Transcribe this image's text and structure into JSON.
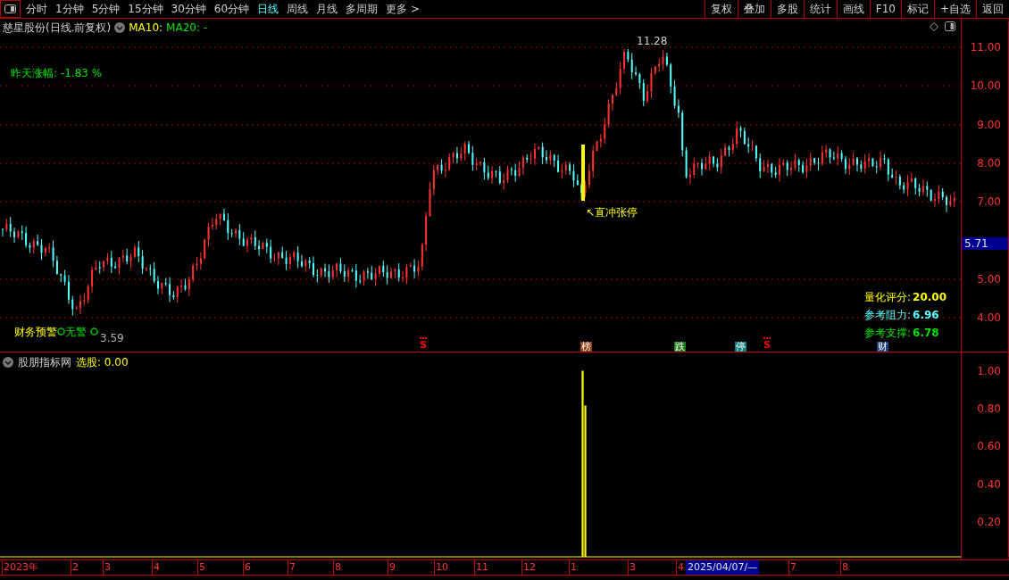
{
  "toolbar": {
    "periods": [
      {
        "label": "分时",
        "selected": false
      },
      {
        "label": "1分钟",
        "selected": false
      },
      {
        "label": "5分钟",
        "selected": false
      },
      {
        "label": "15分钟",
        "selected": false
      },
      {
        "label": "30分钟",
        "selected": false
      },
      {
        "label": "60分钟",
        "selected": false
      },
      {
        "label": "日线",
        "selected": true
      },
      {
        "label": "周线",
        "selected": false
      },
      {
        "label": "月线",
        "selected": false
      },
      {
        "label": "多周期",
        "selected": false
      },
      {
        "label": "更多 >",
        "selected": false
      }
    ],
    "buttons": [
      "复权",
      "叠加",
      "多股",
      "统计",
      "画线",
      "F10",
      "标记",
      "+自选",
      "返回"
    ]
  },
  "main_chart": {
    "title": "慈星股份(日线.前复权)",
    "ma10": "MA10:",
    "ma20": "MA20: -",
    "yesterday_change": "昨天涨幅: -1.83 %",
    "high_label": "11.28",
    "low_label": "3.59",
    "limit_up_label": "↖直冲张停",
    "finance_warning": "财务预警",
    "warning_status": "无警",
    "stats": [
      {
        "label": "量化评分:",
        "value": "20.00",
        "color": "#ffff00"
      },
      {
        "label": "参考阻力:",
        "value": "6.96",
        "color": "#54ffff"
      },
      {
        "label": "参考支撑:",
        "value": "6.78",
        "color": "#00e000"
      }
    ],
    "signals": [
      {
        "text": "S",
        "kind": "arrow",
        "color": "#ff0000"
      },
      {
        "text": "榜",
        "kind": "badge",
        "color": "#8b3a10"
      },
      {
        "text": "跌",
        "kind": "badge",
        "color": "#1a7a1a"
      },
      {
        "text": "停",
        "kind": "badge",
        "color": "#0e7f7f"
      },
      {
        "text": "S",
        "kind": "arrow",
        "color": "#ff0000"
      },
      {
        "text": "财",
        "kind": "badge",
        "color": "#1c3f7a"
      }
    ],
    "axis_labels": [
      "11.00",
      "10.00",
      "9.00",
      "8.00",
      "7.00",
      "5.00",
      "4.00"
    ],
    "current_price": "5.71"
  },
  "indicator": {
    "name": "股朋指标网",
    "reading": "选股: 0.00",
    "axis_labels": [
      "1.00",
      "0.80",
      "0.60",
      "0.40",
      "0.20"
    ]
  },
  "date_axis": {
    "labels": [
      "2023年",
      "2",
      "3",
      "4",
      "5",
      "6",
      "7",
      "8",
      "9",
      "10",
      "11",
      "12",
      "1",
      "3",
      "4",
      "7",
      "8"
    ],
    "cursor_date": "2025/04/07/—"
  }
}
